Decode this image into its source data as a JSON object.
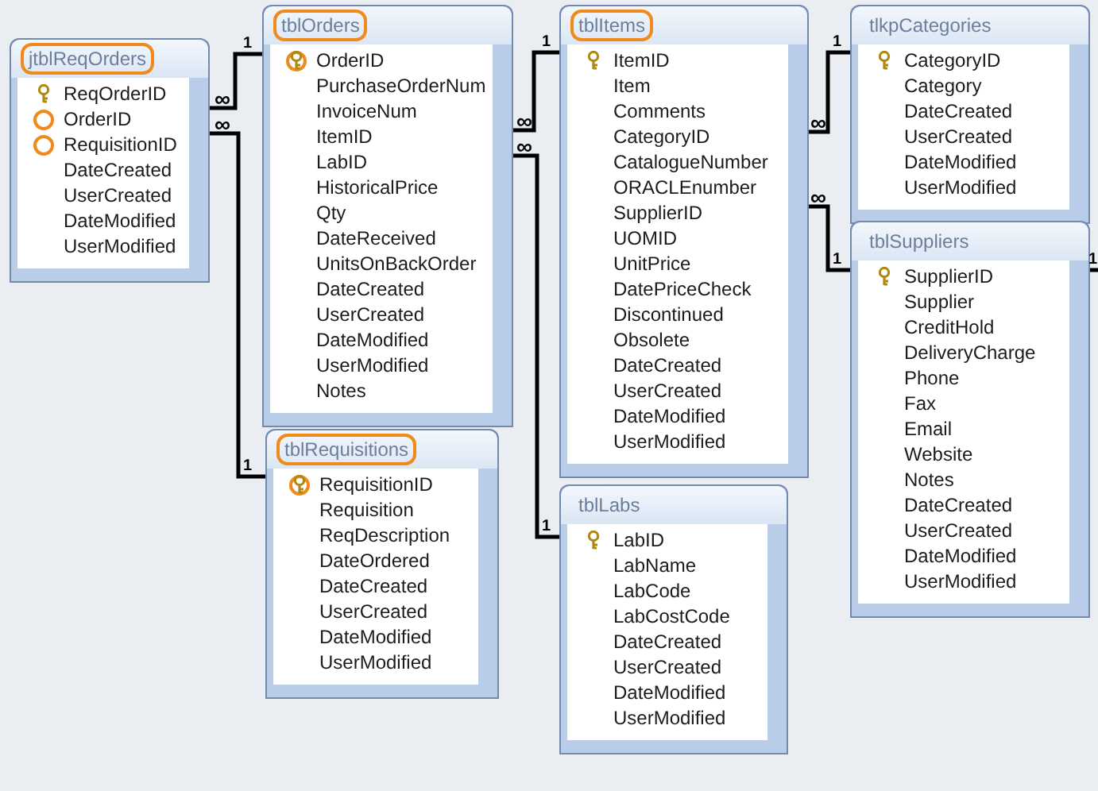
{
  "tables": [
    {
      "name": "jtblReqOrders",
      "highlighted": true,
      "fields": [
        {
          "name": "ReqOrderID",
          "key": true,
          "circled": false
        },
        {
          "name": "OrderID",
          "key": false,
          "circled": true
        },
        {
          "name": "RequisitionID",
          "key": false,
          "circled": true
        },
        {
          "name": "DateCreated",
          "key": false,
          "circled": false
        },
        {
          "name": "UserCreated",
          "key": false,
          "circled": false
        },
        {
          "name": "DateModified",
          "key": false,
          "circled": false
        },
        {
          "name": "UserModified",
          "key": false,
          "circled": false
        }
      ]
    },
    {
      "name": "tblOrders",
      "highlighted": true,
      "fields": [
        {
          "name": "OrderID",
          "key": true,
          "circled": true
        },
        {
          "name": "PurchaseOrderNum",
          "key": false,
          "circled": false
        },
        {
          "name": "InvoiceNum",
          "key": false,
          "circled": false
        },
        {
          "name": "ItemID",
          "key": false,
          "circled": false
        },
        {
          "name": "LabID",
          "key": false,
          "circled": false
        },
        {
          "name": "HistoricalPrice",
          "key": false,
          "circled": false
        },
        {
          "name": "Qty",
          "key": false,
          "circled": false
        },
        {
          "name": "DateReceived",
          "key": false,
          "circled": false
        },
        {
          "name": "UnitsOnBackOrder",
          "key": false,
          "circled": false
        },
        {
          "name": "DateCreated",
          "key": false,
          "circled": false
        },
        {
          "name": "UserCreated",
          "key": false,
          "circled": false
        },
        {
          "name": "DateModified",
          "key": false,
          "circled": false
        },
        {
          "name": "UserModified",
          "key": false,
          "circled": false
        },
        {
          "name": "Notes",
          "key": false,
          "circled": false
        }
      ]
    },
    {
      "name": "tblItems",
      "highlighted": true,
      "fields": [
        {
          "name": "ItemID",
          "key": true,
          "circled": false
        },
        {
          "name": "Item",
          "key": false,
          "circled": false
        },
        {
          "name": "Comments",
          "key": false,
          "circled": false
        },
        {
          "name": "CategoryID",
          "key": false,
          "circled": false
        },
        {
          "name": "CatalogueNumber",
          "key": false,
          "circled": false
        },
        {
          "name": "ORACLEnumber",
          "key": false,
          "circled": false
        },
        {
          "name": "SupplierID",
          "key": false,
          "circled": false
        },
        {
          "name": "UOMID",
          "key": false,
          "circled": false
        },
        {
          "name": "UnitPrice",
          "key": false,
          "circled": false
        },
        {
          "name": "DatePriceCheck",
          "key": false,
          "circled": false
        },
        {
          "name": "Discontinued",
          "key": false,
          "circled": false
        },
        {
          "name": "Obsolete",
          "key": false,
          "circled": false
        },
        {
          "name": "DateCreated",
          "key": false,
          "circled": false
        },
        {
          "name": "UserCreated",
          "key": false,
          "circled": false
        },
        {
          "name": "DateModified",
          "key": false,
          "circled": false
        },
        {
          "name": "UserModified",
          "key": false,
          "circled": false
        }
      ]
    },
    {
      "name": "tlkpCategories",
      "highlighted": false,
      "fields": [
        {
          "name": "CategoryID",
          "key": true,
          "circled": false
        },
        {
          "name": "Category",
          "key": false,
          "circled": false
        },
        {
          "name": "DateCreated",
          "key": false,
          "circled": false
        },
        {
          "name": "UserCreated",
          "key": false,
          "circled": false
        },
        {
          "name": "DateModified",
          "key": false,
          "circled": false
        },
        {
          "name": "UserModified",
          "key": false,
          "circled": false
        }
      ]
    },
    {
      "name": "tblSuppliers",
      "highlighted": false,
      "fields": [
        {
          "name": "SupplierID",
          "key": true,
          "circled": false
        },
        {
          "name": "Supplier",
          "key": false,
          "circled": false
        },
        {
          "name": "CreditHold",
          "key": false,
          "circled": false
        },
        {
          "name": "DeliveryCharge",
          "key": false,
          "circled": false
        },
        {
          "name": "Phone",
          "key": false,
          "circled": false
        },
        {
          "name": "Fax",
          "key": false,
          "circled": false
        },
        {
          "name": "Email",
          "key": false,
          "circled": false
        },
        {
          "name": "Website",
          "key": false,
          "circled": false
        },
        {
          "name": "Notes",
          "key": false,
          "circled": false
        },
        {
          "name": "DateCreated",
          "key": false,
          "circled": false
        },
        {
          "name": "UserCreated",
          "key": false,
          "circled": false
        },
        {
          "name": "DateModified",
          "key": false,
          "circled": false
        },
        {
          "name": "UserModified",
          "key": false,
          "circled": false
        }
      ]
    },
    {
      "name": "tblRequisitions",
      "highlighted": true,
      "fields": [
        {
          "name": "RequisitionID",
          "key": true,
          "circled": true
        },
        {
          "name": "Requisition",
          "key": false,
          "circled": false
        },
        {
          "name": "ReqDescription",
          "key": false,
          "circled": false
        },
        {
          "name": "DateOrdered",
          "key": false,
          "circled": false
        },
        {
          "name": "DateCreated",
          "key": false,
          "circled": false
        },
        {
          "name": "UserCreated",
          "key": false,
          "circled": false
        },
        {
          "name": "DateModified",
          "key": false,
          "circled": false
        },
        {
          "name": "UserModified",
          "key": false,
          "circled": false
        }
      ]
    },
    {
      "name": "tblLabs",
      "highlighted": false,
      "fields": [
        {
          "name": "LabID",
          "key": true,
          "circled": false
        },
        {
          "name": "LabName",
          "key": false,
          "circled": false
        },
        {
          "name": "LabCode",
          "key": false,
          "circled": false
        },
        {
          "name": "LabCostCode",
          "key": false,
          "circled": false
        },
        {
          "name": "DateCreated",
          "key": false,
          "circled": false
        },
        {
          "name": "UserCreated",
          "key": false,
          "circled": false
        },
        {
          "name": "DateModified",
          "key": false,
          "circled": false
        },
        {
          "name": "UserModified",
          "key": false,
          "circled": false
        }
      ]
    }
  ],
  "relationships": [
    {
      "many_label": "∞",
      "one_label": "1"
    },
    {
      "many_label": "∞",
      "one_label": "1"
    },
    {
      "many_label": "∞",
      "one_label": "1"
    },
    {
      "many_label": "∞",
      "one_label": "1"
    },
    {
      "many_label": "∞",
      "one_label": "1"
    },
    {
      "many_label": "∞",
      "one_label": "1"
    },
    {
      "one_label": "1"
    }
  ]
}
